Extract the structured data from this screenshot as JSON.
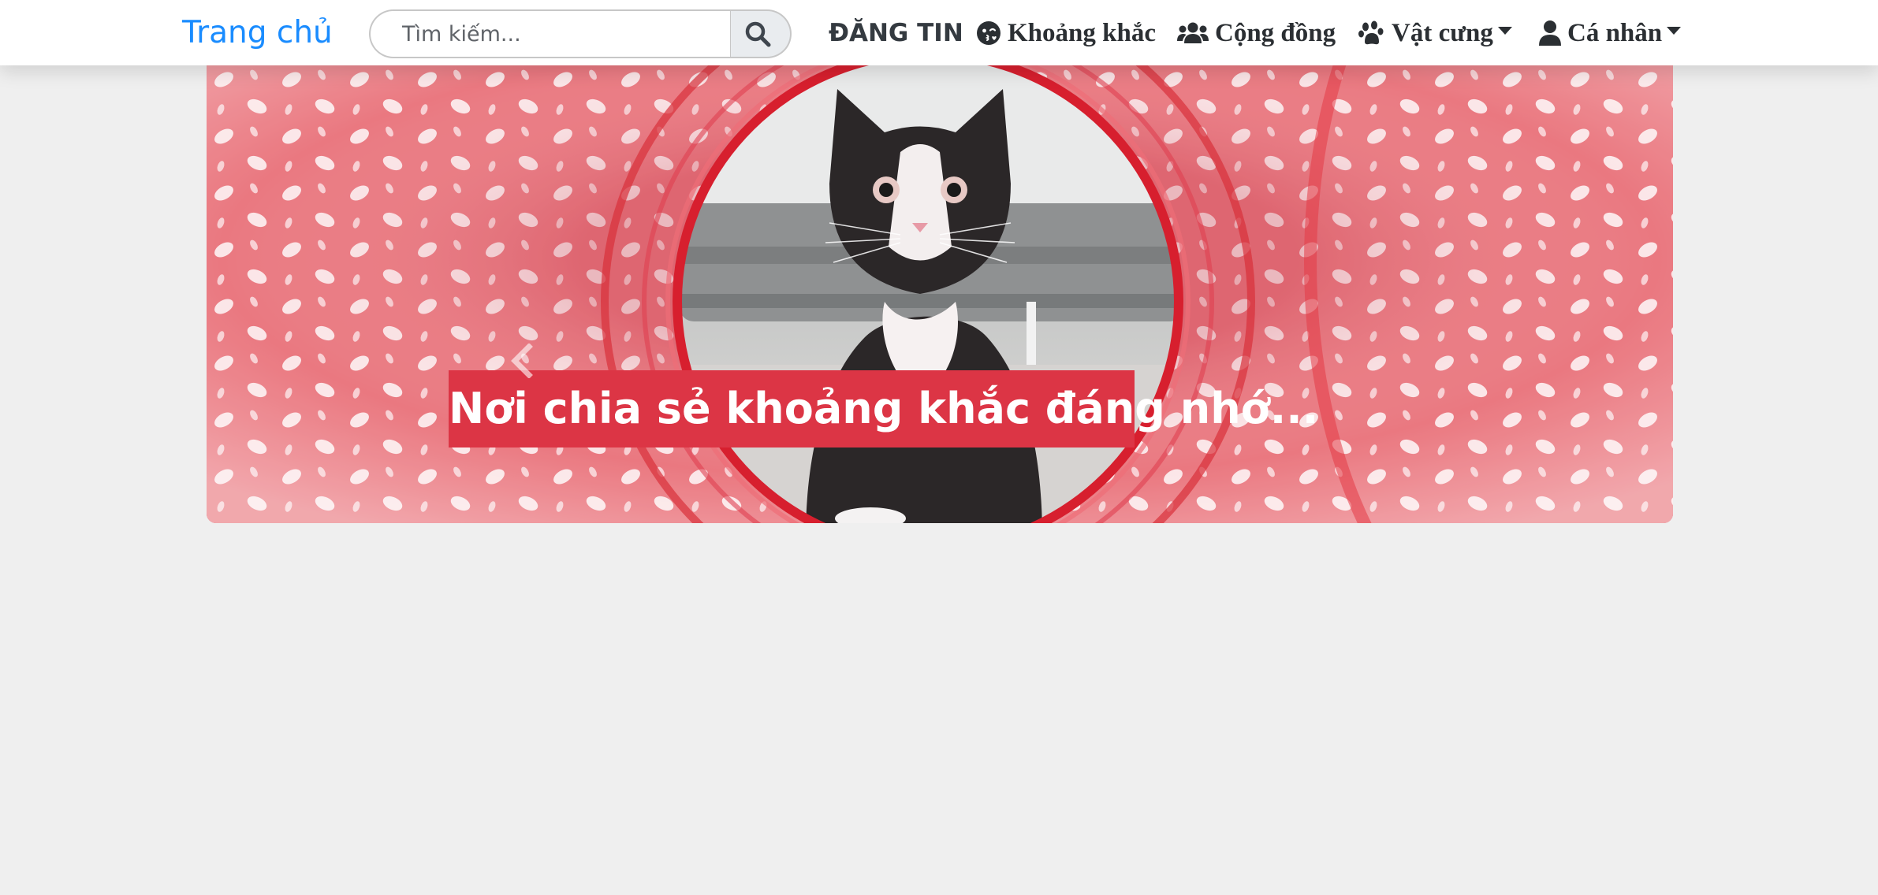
{
  "navbar": {
    "brand": "Trang chủ",
    "search": {
      "placeholder": "Tìm kiếm...",
      "value": "",
      "button_icon": "search-icon"
    },
    "items": [
      {
        "label": "ĐĂNG TIN",
        "icon": null
      },
      {
        "label": "Khoảng khắc",
        "icon": "face-kiss-icon"
      },
      {
        "label": "Cộng đồng",
        "icon": "users-icon"
      },
      {
        "label": "Vật cưng",
        "icon": "paw-icon",
        "dropdown": true
      },
      {
        "label": "Cá nhân",
        "icon": "user-icon",
        "dropdown": true
      }
    ]
  },
  "carousel": {
    "caption": "Nơi chia sẻ khoảng khắc đáng nhớ...",
    "prev_icon": "chevron-left-icon",
    "next_icon": "chevron-right-icon",
    "image": "black-and-white-cat-in-red-tunnel-photo"
  },
  "colors": {
    "background": "#efefef",
    "brand": "#1a8cff",
    "caption_bg": "#dc3545",
    "nav_text": "#2b2f33"
  }
}
